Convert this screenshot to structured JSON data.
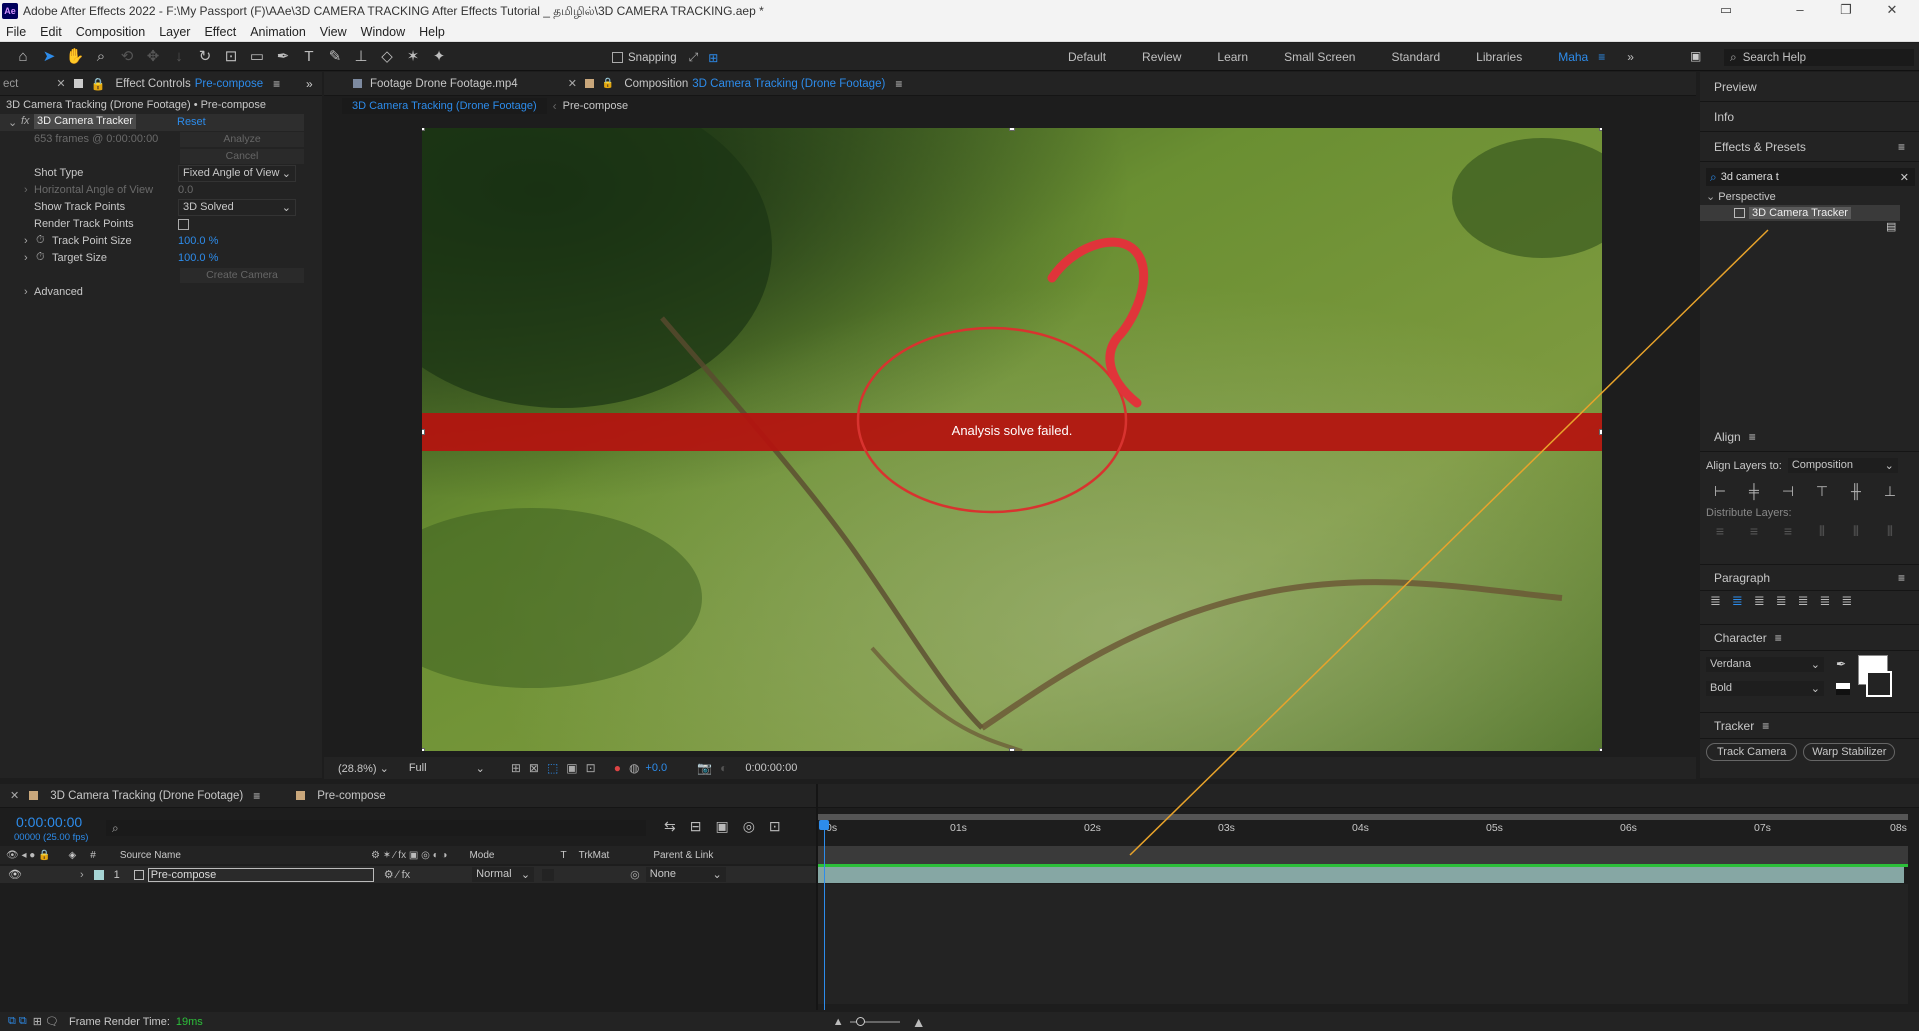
{
  "window": {
    "title": "Adobe After Effects 2022 - F:\\My Passport (F)\\AAe\\3D CAMERA TRACKING After Effects Tutorial _ தமிழில்\\3D CAMERA TRACKING.aep *",
    "app_icon": "Ae"
  },
  "menu": [
    "File",
    "Edit",
    "Composition",
    "Layer",
    "Effect",
    "Animation",
    "View",
    "Window",
    "Help"
  ],
  "toolbar": {
    "snapping": "Snapping",
    "workspaces": [
      "Default",
      "Review",
      "Learn",
      "Small Screen",
      "Standard",
      "Libraries",
      "Maha"
    ],
    "active_workspace": "Maha",
    "search_help": "Search Help"
  },
  "left_panel": {
    "cut_tab": "ect",
    "tab_label": "Effect Controls",
    "tab_target": "Pre-compose",
    "breadcrumb": "3D Camera Tracking (Drone Footage) • Pre-compose",
    "fx": "fx",
    "effect_name": "3D Camera Tracker",
    "reset": "Reset",
    "frames_info": "653 frames @ 0:00:00:00",
    "analyze": "Analyze",
    "cancel": "Cancel",
    "props": {
      "shot_type": "Shot Type",
      "shot_type_val": "Fixed Angle of View",
      "hfov": "Horizontal Angle of View",
      "hfov_val": "0.0",
      "show_track": "Show Track Points",
      "show_track_val": "3D Solved",
      "render_track": "Render Track Points",
      "track_size": "Track Point Size",
      "track_size_val": "100.0 %",
      "target_size": "Target Size",
      "target_size_val": "100.0 %",
      "create_camera": "Create Camera",
      "advanced": "Advanced"
    }
  },
  "viewer": {
    "footage_tab": "Footage  Drone Footage.mp4",
    "comp_tab_prefix": "Composition",
    "comp_tab_name": "3D Camera Tracking (Drone Footage)",
    "crumb1": "3D Camera Tracking (Drone Footage)",
    "crumb2": "Pre-compose",
    "banner": "Analysis solve failed.",
    "zoom": "(28.8%)",
    "resolution": "Full",
    "exposure": "+0.0",
    "timecode": "0:00:00:00"
  },
  "right_panel": {
    "preview": "Preview",
    "info": "Info",
    "effects_presets": "Effects & Presets",
    "search_value": "3d camera t",
    "category": "Perspective",
    "item": "3D Camera Tracker",
    "align": "Align",
    "align_layers_to": "Align Layers to:",
    "align_target": "Composition",
    "distribute": "Distribute Layers:",
    "paragraph": "Paragraph",
    "character": "Character",
    "font": "Verdana",
    "font_style": "Bold",
    "tracker": "Tracker",
    "track_camera": "Track Camera",
    "warp_stabilizer": "Warp Stabilizer"
  },
  "timeline": {
    "tab": "3D Camera Tracking (Drone Footage)",
    "tab2": "Pre-compose",
    "timecode": "0:00:00:00",
    "fps": "00000 (25.00 fps)",
    "columns": {
      "num": "#",
      "source": "Source Name",
      "mode": "Mode",
      "t": "T",
      "trkmat": "TrkMat",
      "parent": "Parent & Link"
    },
    "layer": {
      "num": "1",
      "name": "Pre-compose",
      "mode": "Normal",
      "parent": "None"
    },
    "ruler": [
      "0s",
      "01s",
      "02s",
      "03s",
      "04s",
      "05s",
      "06s",
      "07s",
      "08s"
    ],
    "render_label": "Frame Render Time:",
    "render_time": "19ms"
  }
}
